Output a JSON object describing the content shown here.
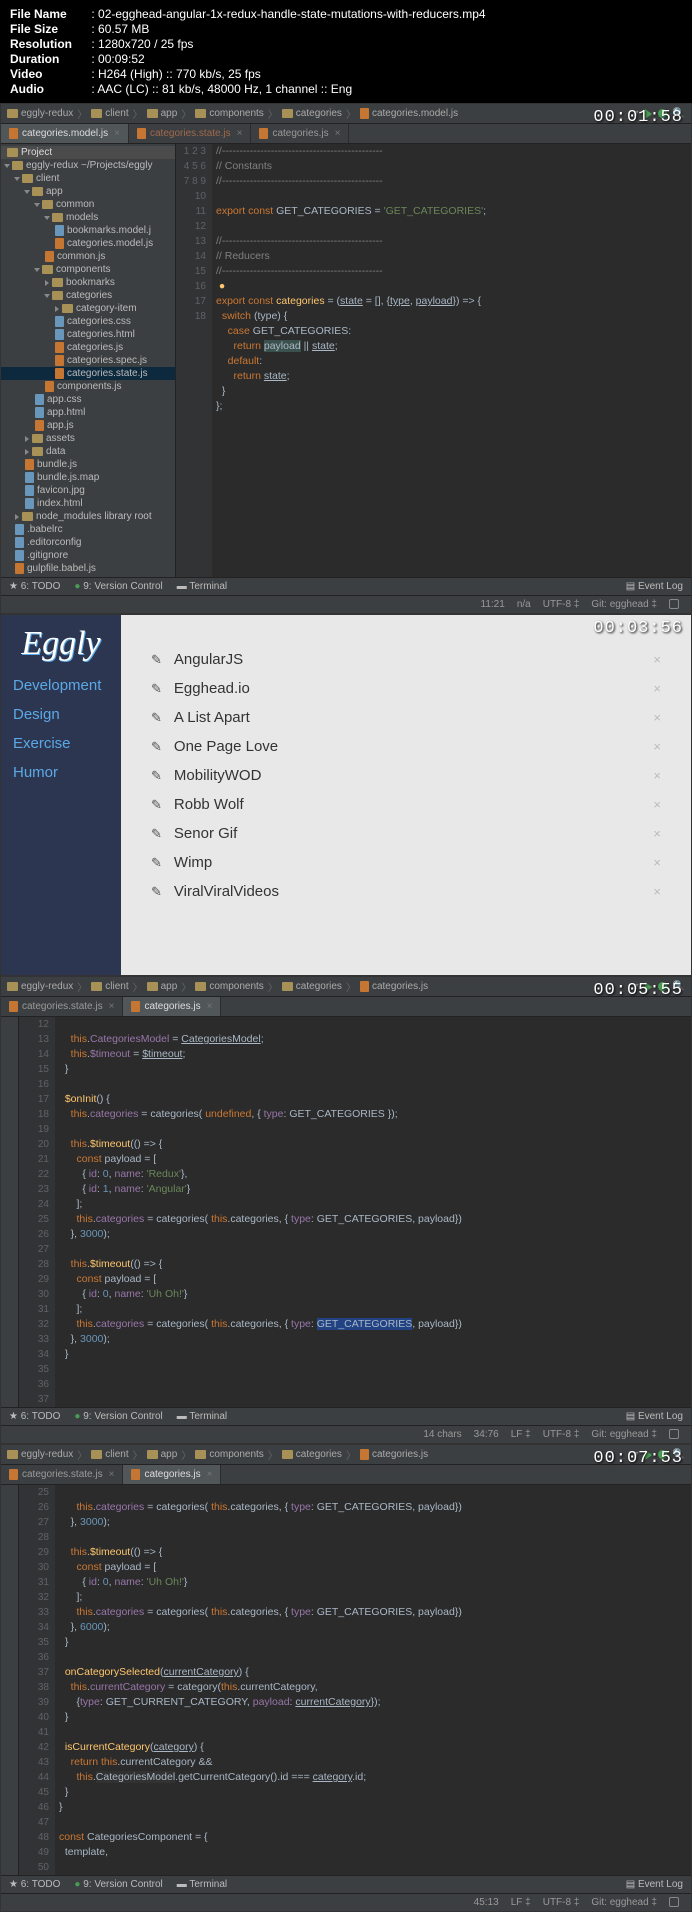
{
  "fileinfo": {
    "name_label": "File Name",
    "name": "02-egghead-angular-1x-redux-handle-state-mutations-with-reducers.mp4",
    "size_label": "File Size",
    "size": "60.57 MB",
    "res_label": "Resolution",
    "res": "1280x720 / 25 fps",
    "dur_label": "Duration",
    "dur": "00:09:52",
    "video_label": "Video",
    "video": "H264 (High) :: 770 kb/s, 25 fps",
    "audio_label": "Audio",
    "audio": "AAC (LC) :: 81 kb/s, 48000 Hz, 1 channel :: Eng"
  },
  "panel1": {
    "timestamp": "00:01:58",
    "breadcrumb": [
      "eggly-redux",
      "client",
      "app",
      "components",
      "categories",
      "categories.model.js"
    ],
    "tabs": [
      {
        "label": "categories.model.js",
        "active": true
      },
      {
        "label": "categories.state.js",
        "active": false,
        "dim": true
      },
      {
        "label": "categories.js",
        "active": false
      }
    ],
    "project_header": "Project",
    "tree": [
      {
        "t": "eggly-redux ~/Projects/eggly",
        "lvl": 0,
        "folder": true,
        "open": true
      },
      {
        "t": "client",
        "lvl": 1,
        "folder": true,
        "open": true
      },
      {
        "t": "app",
        "lvl": 2,
        "folder": true,
        "open": true
      },
      {
        "t": "common",
        "lvl": 3,
        "folder": true,
        "open": true
      },
      {
        "t": "models",
        "lvl": 4,
        "folder": true,
        "open": true
      },
      {
        "t": "bookmarks.model.j",
        "lvl": 5,
        "file": true
      },
      {
        "t": "categories.model.js",
        "lvl": 5,
        "file": true
      },
      {
        "t": "common.js",
        "lvl": 4,
        "file": true
      },
      {
        "t": "components",
        "lvl": 3,
        "folder": true,
        "open": true
      },
      {
        "t": "bookmarks",
        "lvl": 4,
        "folder": true
      },
      {
        "t": "categories",
        "lvl": 4,
        "folder": true,
        "open": true
      },
      {
        "t": "category-item",
        "lvl": 5,
        "folder": true
      },
      {
        "t": "categories.css",
        "lvl": 5,
        "file": true
      },
      {
        "t": "categories.html",
        "lvl": 5,
        "file": true
      },
      {
        "t": "categories.js",
        "lvl": 5,
        "file": true
      },
      {
        "t": "categories.spec.js",
        "lvl": 5,
        "file": true
      },
      {
        "t": "categories.state.js",
        "lvl": 5,
        "file": true,
        "sel": true
      },
      {
        "t": "components.js",
        "lvl": 4,
        "file": true
      },
      {
        "t": "app.css",
        "lvl": 3,
        "file": true
      },
      {
        "t": "app.html",
        "lvl": 3,
        "file": true
      },
      {
        "t": "app.js",
        "lvl": 3,
        "file": true
      },
      {
        "t": "assets",
        "lvl": 2,
        "folder": true
      },
      {
        "t": "data",
        "lvl": 2,
        "folder": true
      },
      {
        "t": "bundle.js",
        "lvl": 2,
        "file": true
      },
      {
        "t": "bundle.js.map",
        "lvl": 2,
        "file": true
      },
      {
        "t": "favicon.jpg",
        "lvl": 2,
        "file": true
      },
      {
        "t": "index.html",
        "lvl": 2,
        "file": true
      },
      {
        "t": "node_modules library root",
        "lvl": 1,
        "folder": true
      },
      {
        "t": ".babelrc",
        "lvl": 1,
        "file": true
      },
      {
        "t": ".editorconfig",
        "lvl": 1,
        "file": true
      },
      {
        "t": ".gitignore",
        "lvl": 1,
        "file": true
      },
      {
        "t": "gulpfile.babel.js",
        "lvl": 1,
        "file": true
      }
    ],
    "line_start": 1,
    "line_end": 18,
    "bottom_tools": {
      "todo": "6: TODO",
      "vcs": "9: Version Control",
      "term": "Terminal",
      "eventlog": "Event Log"
    },
    "status": {
      "pos": "11:21",
      "na": "n/a",
      "enc": "UTF-8 ‡",
      "git": "Git: egghead ‡"
    }
  },
  "panel2": {
    "timestamp": "00:03:56",
    "logo": "Eggly",
    "categories": [
      "Development",
      "Design",
      "Exercise",
      "Humor"
    ],
    "bookmarks": [
      "AngularJS",
      "Egghead.io",
      "A List Apart",
      "One Page Love",
      "MobilityWOD",
      "Robb Wolf",
      "Senor Gif",
      "Wimp",
      "ViralViralVideos"
    ]
  },
  "panel3": {
    "timestamp": "00:05:55",
    "breadcrumb": [
      "eggly-redux",
      "client",
      "app",
      "components",
      "categories",
      "categories.js"
    ],
    "tabs": [
      {
        "label": "categories.state.js"
      },
      {
        "label": "categories.js",
        "active": true
      }
    ],
    "line_start": 12,
    "line_end": 37,
    "bottom_tools": {
      "todo": "6: TODO",
      "vcs": "9: Version Control",
      "term": "Terminal",
      "eventlog": "Event Log"
    },
    "status": {
      "chars": "14 chars",
      "pos": "34:76",
      "lf": "LF ‡",
      "enc": "UTF-8 ‡",
      "git": "Git: egghead ‡"
    }
  },
  "panel4": {
    "timestamp": "00:07:53",
    "breadcrumb": [
      "eggly-redux",
      "client",
      "app",
      "components",
      "categories",
      "categories.js"
    ],
    "tabs": [
      {
        "label": "categories.state.js"
      },
      {
        "label": "categories.js",
        "active": true
      }
    ],
    "line_start": 25,
    "line_end": 50,
    "bottom_tools": {
      "todo": "6: TODO",
      "vcs": "9: Version Control",
      "term": "Terminal",
      "eventlog": "Event Log"
    },
    "status": {
      "pos": "45:13",
      "lf": "LF ‡",
      "enc": "UTF-8 ‡",
      "git": "Git: egghead ‡"
    }
  }
}
